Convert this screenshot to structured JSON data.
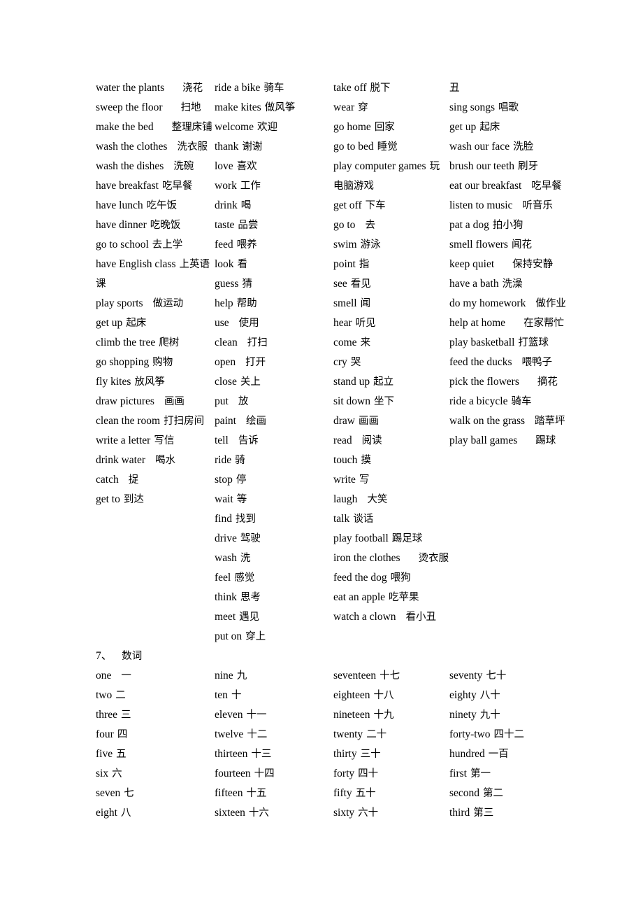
{
  "document": {
    "section_heading": {
      "number": "7、",
      "label": "数词"
    }
  },
  "vocabulary": {
    "columns": [
      {
        "id": "col-1",
        "entries": [
          {
            "en": "water the plants",
            "zh": "浇花",
            "gap": "L"
          },
          {
            "en": "sweep the floor",
            "zh": "扫地",
            "gap": "L"
          },
          {
            "en": "make the bed",
            "zh": "整理床铺",
            "gap": "L"
          },
          {
            "en": "wash the clothes",
            "zh": "洗衣服",
            "gap": "M"
          },
          {
            "en": "wash the dishes",
            "zh": "洗碗",
            "gap": "M"
          },
          {
            "en": "have breakfast",
            "zh": "吃早餐",
            "gap": "S"
          },
          {
            "en": "have lunch",
            "zh": "吃午饭",
            "gap": "S"
          },
          {
            "en": "have dinner",
            "zh": "吃晚饭",
            "gap": "S"
          },
          {
            "en": "go to school",
            "zh": "去上学",
            "gap": "S"
          },
          {
            "en": "have  English  class",
            "zh": "上英语课",
            "gap": "S"
          },
          {
            "en": "play sports",
            "zh": "做运动",
            "gap": "M"
          },
          {
            "en": "get up",
            "zh": "起床",
            "gap": "S"
          },
          {
            "en": "climb the tree",
            "zh": "爬树",
            "gap": "S"
          },
          {
            "en": "go shopping",
            "zh": "购物",
            "gap": "S"
          },
          {
            "en": "fly kites",
            "zh": "放风筝",
            "gap": "S"
          },
          {
            "en": "draw pictures",
            "zh": "画画",
            "gap": "M"
          },
          {
            "en": "clean the room",
            "zh": "打扫房间",
            "gap": "S"
          },
          {
            "en": "write a letter",
            "zh": "写信",
            "gap": "S"
          },
          {
            "en": "drink water",
            "zh": "喝水",
            "gap": "M"
          },
          {
            "en": "catch",
            "zh": "捉",
            "gap": "M"
          },
          {
            "en": "get to",
            "zh": "到达",
            "gap": "S"
          }
        ]
      },
      {
        "id": "col-2",
        "entries": [
          {
            "en": "ride a bike",
            "zh": "骑车",
            "gap": "S"
          },
          {
            "en": "make kites",
            "zh": "做风筝",
            "gap": "S"
          },
          {
            "en": "welcome",
            "zh": "欢迎",
            "gap": "S"
          },
          {
            "en": "thank",
            "zh": "谢谢",
            "gap": "S"
          },
          {
            "en": "love",
            "zh": "喜欢",
            "gap": "S"
          },
          {
            "en": "work",
            "zh": "工作",
            "gap": "S"
          },
          {
            "en": "drink",
            "zh": "喝",
            "gap": "S"
          },
          {
            "en": "taste",
            "zh": "品尝",
            "gap": "S"
          },
          {
            "en": "feed",
            "zh": "喂养",
            "gap": "S"
          },
          {
            "en": "look",
            "zh": "看",
            "gap": "S"
          },
          {
            "en": "guess",
            "zh": "猜",
            "gap": "S"
          },
          {
            "en": "help",
            "zh": "帮助",
            "gap": "S"
          },
          {
            "en": "use",
            "zh": "使用",
            "gap": "M"
          },
          {
            "en": "clean",
            "zh": "打扫",
            "gap": "M"
          },
          {
            "en": "open",
            "zh": "打开",
            "gap": "M"
          },
          {
            "en": "close",
            "zh": "关上",
            "gap": "S"
          },
          {
            "en": "put",
            "zh": "放",
            "gap": "M"
          },
          {
            "en": "paint",
            "zh": "绘画",
            "gap": "M"
          },
          {
            "en": "tell",
            "zh": "告诉",
            "gap": "M"
          },
          {
            "en": "ride",
            "zh": "骑",
            "gap": "S"
          },
          {
            "en": "stop",
            "zh": "停",
            "gap": "S"
          },
          {
            "en": "wait",
            "zh": "等",
            "gap": "S"
          },
          {
            "en": "find",
            "zh": "找到",
            "gap": "S"
          },
          {
            "en": "drive",
            "zh": "驾驶",
            "gap": "S"
          },
          {
            "en": "wash",
            "zh": "洗",
            "gap": "S"
          },
          {
            "en": "feel",
            "zh": "感觉",
            "gap": "S"
          },
          {
            "en": "think",
            "zh": "思考",
            "gap": "S"
          },
          {
            "en": "meet",
            "zh": "遇见",
            "gap": "S"
          },
          {
            "en": "put on",
            "zh": "穿上",
            "gap": "S"
          }
        ]
      },
      {
        "id": "col-3",
        "entries": [
          {
            "en": "take off",
            "zh": "脱下",
            "gap": "S"
          },
          {
            "en": "wear",
            "zh": "穿",
            "gap": "S"
          },
          {
            "en": "go home",
            "zh": "回家",
            "gap": "S"
          },
          {
            "en": "go to bed",
            "zh": "睡觉",
            "gap": "S"
          },
          {
            "en": "play          computer games",
            "zh": "玩电脑游戏",
            "gap": "S"
          },
          {
            "en": "get off",
            "zh": "下车",
            "gap": "S"
          },
          {
            "en": "go to",
            "zh": "去",
            "gap": "M"
          },
          {
            "en": "swim",
            "zh": "游泳",
            "gap": "S"
          },
          {
            "en": "point",
            "zh": "指",
            "gap": "S"
          },
          {
            "en": "see",
            "zh": "看见",
            "gap": "S"
          },
          {
            "en": "smell",
            "zh": "闻",
            "gap": "S"
          },
          {
            "en": "hear",
            "zh": "听见",
            "gap": "S"
          },
          {
            "en": "come",
            "zh": "来",
            "gap": "S"
          },
          {
            "en": "cry",
            "zh": "哭",
            "gap": "S"
          },
          {
            "en": "stand up",
            "zh": "起立",
            "gap": "S"
          },
          {
            "en": "sit down",
            "zh": "坐下",
            "gap": "S"
          },
          {
            "en": "draw",
            "zh": "画画",
            "gap": "S"
          },
          {
            "en": "read",
            "zh": "阅读",
            "gap": "M"
          },
          {
            "en": "touch",
            "zh": "摸",
            "gap": "S"
          },
          {
            "en": "write",
            "zh": "写",
            "gap": "S"
          },
          {
            "en": "laugh",
            "zh": "大笑",
            "gap": "M"
          },
          {
            "en": "talk",
            "zh": "谈话",
            "gap": "S"
          },
          {
            "en": "play football",
            "zh": "踢足球",
            "gap": "S"
          },
          {
            "en": "iron the clothes",
            "zh": "烫衣服",
            "gap": "L"
          },
          {
            "en": "feed the dog",
            "zh": "喂狗",
            "gap": "S"
          },
          {
            "en": "eat an apple",
            "zh": "吃苹果",
            "gap": "S"
          },
          {
            "en": "watch a clown",
            "zh": "看小丑",
            "gap": "M"
          }
        ]
      },
      {
        "id": "col-4",
        "entries": [
          {
            "en": "",
            "zh": "丑",
            "gap": "S"
          },
          {
            "en": "sing songs",
            "zh": "唱歌",
            "gap": "S"
          },
          {
            "en": "get up",
            "zh": "起床",
            "gap": "S"
          },
          {
            "en": "wash our face",
            "zh": "洗脸",
            "gap": "S"
          },
          {
            "en": "brush our teeth",
            "zh": "刷牙",
            "gap": "S"
          },
          {
            "en": "eat our breakfast",
            "zh": "吃早餐",
            "gap": "M"
          },
          {
            "en": "listen to music",
            "zh": "听音乐",
            "gap": "M"
          },
          {
            "en": "pat a dog",
            "zh": "拍小狗",
            "gap": "S"
          },
          {
            "en": "smell flowers",
            "zh": "闻花",
            "gap": "S"
          },
          {
            "en": "keep quiet",
            "zh": "保持安静",
            "gap": "L"
          },
          {
            "en": "have a bath",
            "zh": "洗澡",
            "gap": "S"
          },
          {
            "en": "do my homework",
            "zh": "做作业",
            "gap": "M"
          },
          {
            "en": "help at home",
            "zh": "在家帮忙",
            "gap": "L"
          },
          {
            "en": "play basketball",
            "zh": "打篮球",
            "gap": "S"
          },
          {
            "en": "feed the ducks",
            "zh": "喂鸭子",
            "gap": "M"
          },
          {
            "en": "pick the flowers",
            "zh": "摘花",
            "gap": "L"
          },
          {
            "en": "ride a bicycle",
            "zh": "骑车",
            "gap": "S"
          },
          {
            "en": "walk on the grass",
            "zh": "踏草坪",
            "gap": "M"
          },
          {
            "en": "play ball games",
            "zh": "踢球",
            "gap": "L"
          }
        ]
      }
    ]
  },
  "numbers": {
    "columns": [
      {
        "id": "num-col-1",
        "entries": [
          {
            "en": "one",
            "zh": "一",
            "gap": "M"
          },
          {
            "en": "two",
            "zh": "二",
            "gap": "S"
          },
          {
            "en": "three",
            "zh": "三",
            "gap": "S"
          },
          {
            "en": "four",
            "zh": "四",
            "gap": "S"
          },
          {
            "en": "five",
            "zh": "五",
            "gap": "S"
          },
          {
            "en": "six",
            "zh": "六",
            "gap": "S"
          },
          {
            "en": "seven",
            "zh": "七",
            "gap": "S"
          },
          {
            "en": "eight",
            "zh": "八",
            "gap": "S"
          }
        ]
      },
      {
        "id": "num-col-2",
        "entries": [
          {
            "en": "nine",
            "zh": "九",
            "gap": "S"
          },
          {
            "en": "ten",
            "zh": "十",
            "gap": "S"
          },
          {
            "en": "eleven",
            "zh": "十一",
            "gap": "S"
          },
          {
            "en": "twelve",
            "zh": "十二",
            "gap": "S"
          },
          {
            "en": "thirteen",
            "zh": "十三",
            "gap": "S"
          },
          {
            "en": "fourteen",
            "zh": "十四",
            "gap": "S"
          },
          {
            "en": "fifteen",
            "zh": "十五",
            "gap": "S"
          },
          {
            "en": "sixteen",
            "zh": "十六",
            "gap": "S"
          }
        ]
      },
      {
        "id": "num-col-3",
        "entries": [
          {
            "en": "seventeen",
            "zh": "十七",
            "gap": "S"
          },
          {
            "en": "eighteen",
            "zh": "十八",
            "gap": "S"
          },
          {
            "en": "nineteen",
            "zh": "十九",
            "gap": "S"
          },
          {
            "en": "twenty",
            "zh": "二十",
            "gap": "S"
          },
          {
            "en": "thirty",
            "zh": "三十",
            "gap": "S"
          },
          {
            "en": "forty",
            "zh": "四十",
            "gap": "S"
          },
          {
            "en": "fifty",
            "zh": "五十",
            "gap": "S"
          },
          {
            "en": "sixty",
            "zh": "六十",
            "gap": "S"
          }
        ]
      },
      {
        "id": "num-col-4",
        "entries": [
          {
            "en": "seventy",
            "zh": "七十",
            "gap": "S"
          },
          {
            "en": "eighty",
            "zh": "八十",
            "gap": "S"
          },
          {
            "en": "ninety",
            "zh": "九十",
            "gap": "S"
          },
          {
            "en": "forty-two",
            "zh": "四十二",
            "gap": "S"
          },
          {
            "en": "hundred",
            "zh": "一百",
            "gap": "S"
          },
          {
            "en": "first",
            "zh": "第一",
            "gap": "S"
          },
          {
            "en": "second",
            "zh": "第二",
            "gap": "S"
          },
          {
            "en": "third",
            "zh": "第三",
            "gap": "S"
          }
        ]
      }
    ]
  }
}
